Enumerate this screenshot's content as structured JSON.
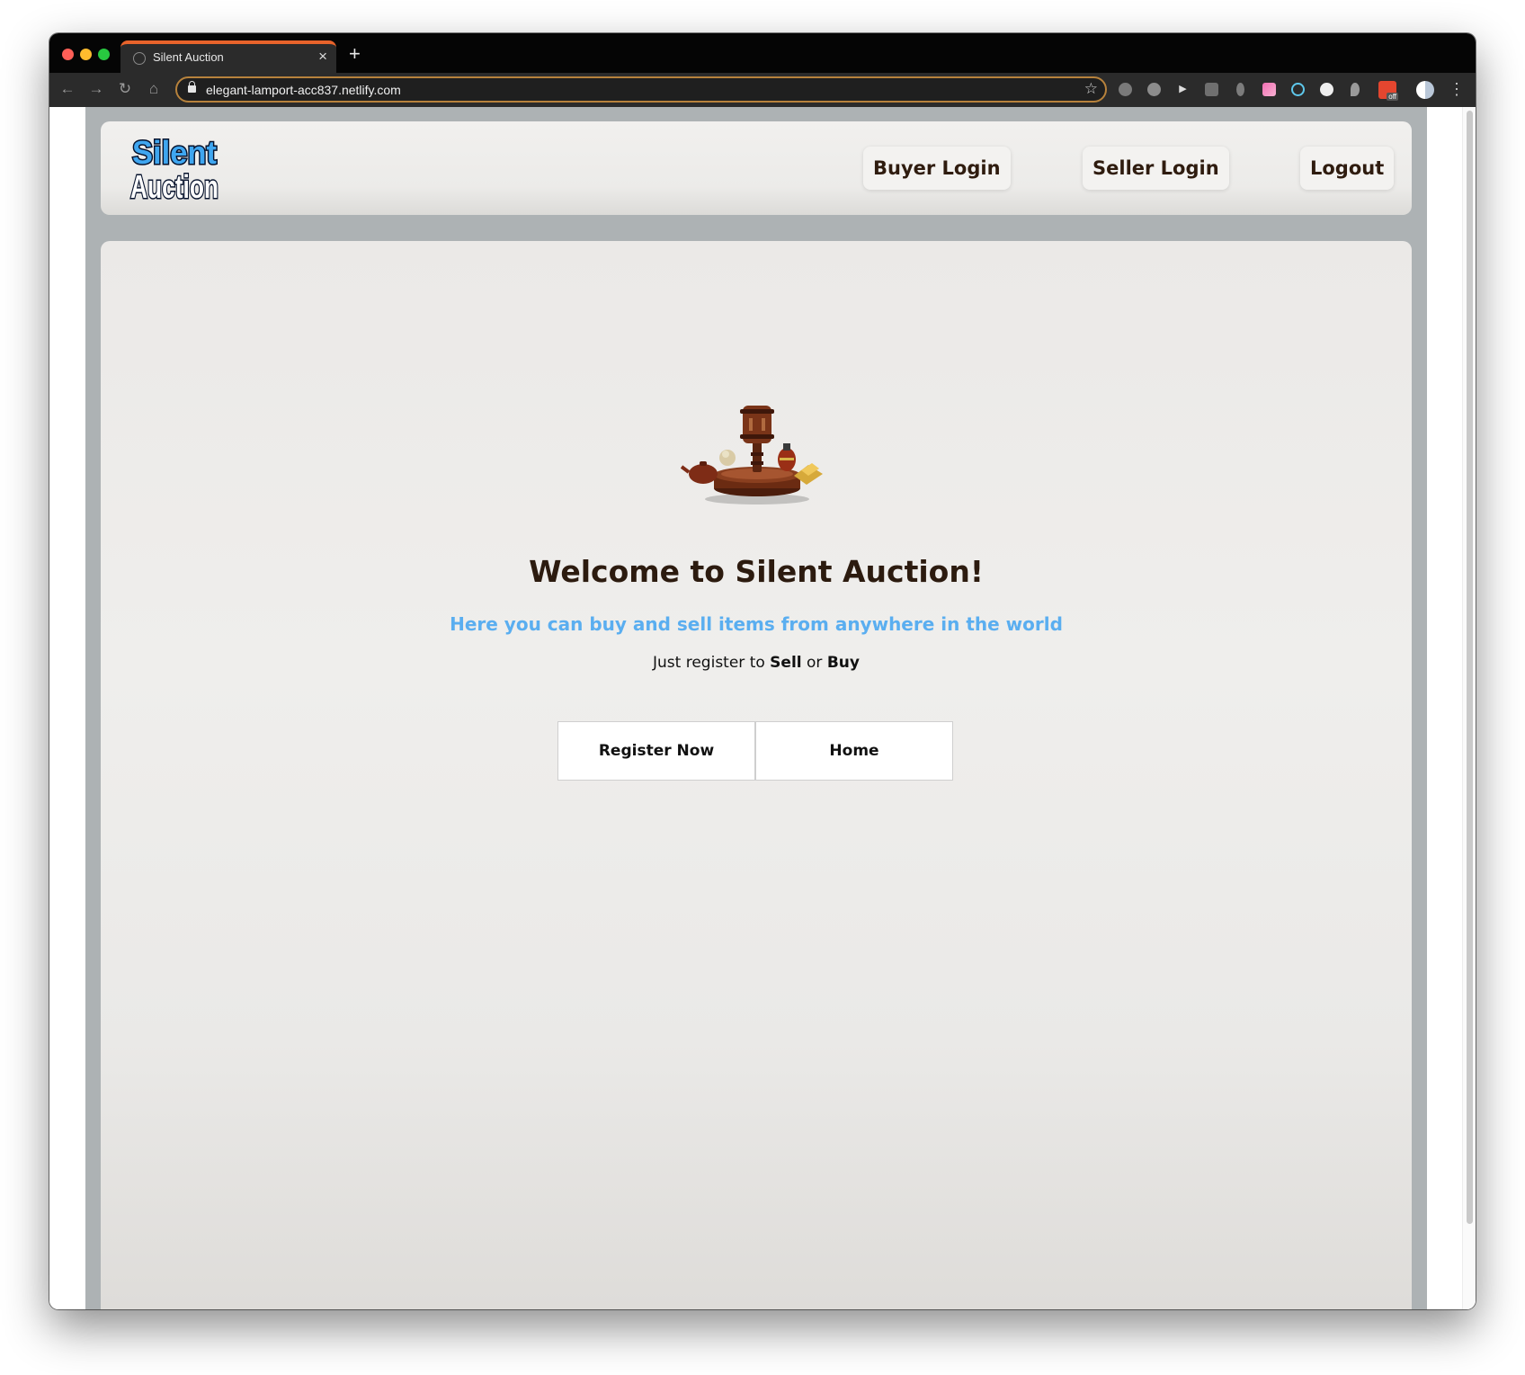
{
  "browser": {
    "tab_title": "Silent Auction",
    "tab_close": "×",
    "new_tab": "+",
    "url": "elegant-lamport-acc837.netlify.com",
    "extension_badge": "off"
  },
  "navbar": {
    "logo_line1": "Silent",
    "logo_line2": "Auction",
    "links": [
      {
        "label": "Buyer Login"
      },
      {
        "label": "Seller Login"
      },
      {
        "label": "Logout"
      }
    ]
  },
  "main": {
    "title": "Welcome to Silent Auction!",
    "subtitle": "Here you can buy and sell items from anywhere in the world",
    "hint_prefix": "Just register to ",
    "hint_sell": "Sell",
    "hint_or": " or ",
    "hint_buy": "Buy",
    "buttons": {
      "register": "Register Now",
      "home": "Home"
    }
  },
  "colors": {
    "accent_tab": "#e8632b",
    "subtitle": "#5aaef0",
    "heading": "#2c1b0f",
    "frame": "#adb2b4"
  }
}
